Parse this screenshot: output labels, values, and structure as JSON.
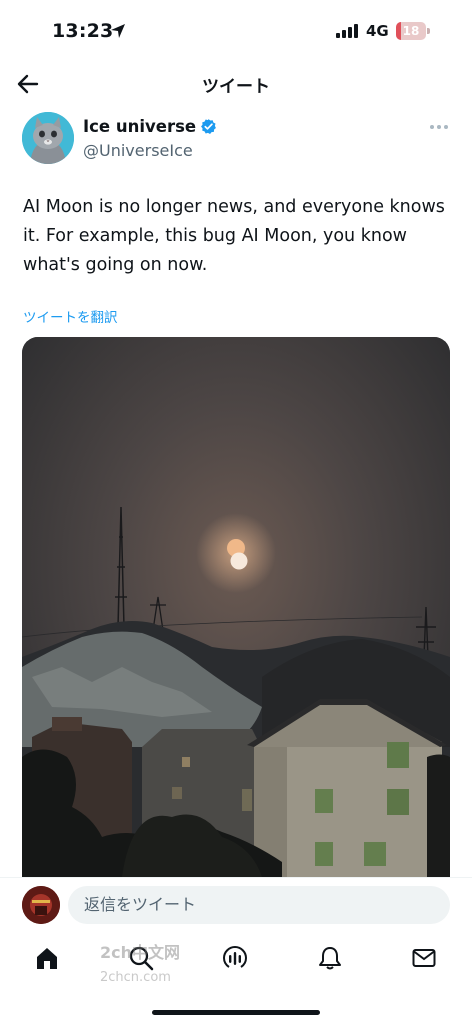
{
  "status_bar": {
    "time": "13:23",
    "network": "4G",
    "battery": "18",
    "battery_level": 0.18
  },
  "header": {
    "title": "ツイート"
  },
  "tweet": {
    "author_name": "Ice universe",
    "author_handle": "@UniverseIce",
    "text": "AI Moon is no longer news, and everyone knows\nit. For example, this bug  AI Moon, you know\nwhat's going on now.",
    "translate_label": "ツイートを翻訳"
  },
  "reply": {
    "placeholder": "返信をツイート"
  },
  "tabs": [
    {
      "name": "home",
      "icon": "home-icon"
    },
    {
      "name": "search",
      "icon": "search-icon"
    },
    {
      "name": "spaces",
      "icon": "spaces-icon"
    },
    {
      "name": "notifications",
      "icon": "bell-icon"
    },
    {
      "name": "messages",
      "icon": "envelope-icon"
    }
  ],
  "watermark": {
    "line1": "2ch中文网",
    "line2": "2chcn.com"
  },
  "colors": {
    "accent": "#1d9bf0",
    "text": "#0f1419",
    "secondary": "#536471"
  }
}
